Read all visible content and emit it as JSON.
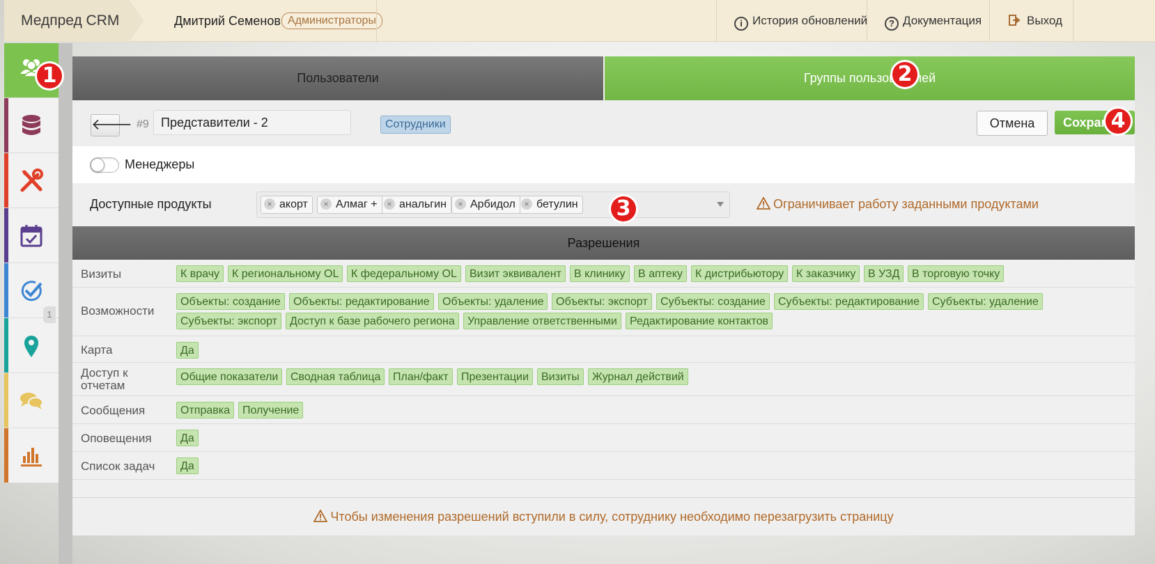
{
  "header": {
    "brand": "Медпред CRM",
    "user_name": "Дмитрий Семенов",
    "user_role": "Администраторы",
    "links": {
      "updates": "История обновлений",
      "docs": "Документация",
      "logout": "Выход"
    }
  },
  "sidebar": {
    "items": [
      {
        "name": "users",
        "icon": "users-icon",
        "color": "#7cc24e"
      },
      {
        "name": "database",
        "icon": "database-icon",
        "color": "#8e3a5a"
      },
      {
        "name": "tools",
        "icon": "tools-icon",
        "color": "#e0402a"
      },
      {
        "name": "calendar",
        "icon": "calendar-check-icon",
        "color": "#5a3f8f"
      },
      {
        "name": "tasks",
        "icon": "check-circle-icon",
        "color": "#3d86d4"
      },
      {
        "name": "map",
        "icon": "map-pin-icon",
        "color": "#1aa39b"
      },
      {
        "name": "messages",
        "icon": "chat-icon",
        "color": "#e7c45e"
      },
      {
        "name": "reports",
        "icon": "bar-chart-icon",
        "color": "#d0752a"
      }
    ],
    "tab_badge": "1"
  },
  "tabs": {
    "users": "Пользователи",
    "groups": "Группы пользователей"
  },
  "group": {
    "id": "#9",
    "name": "Представители - 2",
    "type_badge": "Сотрудники",
    "cancel": "Отмена",
    "save": "Сохранить",
    "managers_toggle": "Менеджеры",
    "managers_on": false
  },
  "products": {
    "label": "Доступные продукты",
    "selected": [
      "акорт",
      "Алмаг +",
      "анальгин",
      "Арбидол",
      "бетулин"
    ],
    "warning": "Ограничивает работу заданными продуктами"
  },
  "permissions": {
    "title": "Разрешения",
    "rows": [
      {
        "label": "Визиты",
        "tags": [
          "К врачу",
          "К региональному OL",
          "К федеральному OL",
          "Визит эквивалент",
          "В клинику",
          "В аптеку",
          "К дистрибьютору",
          "К заказчику",
          "В УЗД",
          "В торговую точку"
        ]
      },
      {
        "label": "Возможности",
        "tags": [
          "Объекты: создание",
          "Объекты: редактирование",
          "Объекты: удаление",
          "Объекты: экспорт",
          "Субъекты: создание",
          "Субъекты: редактирование",
          "Субъекты: удаление",
          "Субъекты: экспорт",
          "Доступ к базе рабочего региона",
          "Управление ответственными",
          "Редактирование контактов"
        ]
      },
      {
        "label": "Карта",
        "tags": [
          "Да"
        ]
      },
      {
        "label": "Доступ к отчетам",
        "tags": [
          "Общие показатели",
          "Сводная таблица",
          "План/факт",
          "Презентации",
          "Визиты",
          "Журнал действий"
        ]
      },
      {
        "label": "Сообщения",
        "tags": [
          "Отправка",
          "Получение"
        ]
      },
      {
        "label": "Оповещения",
        "tags": [
          "Да"
        ]
      },
      {
        "label": "Список задач",
        "tags": [
          "Да"
        ]
      }
    ],
    "footer_warning": "Чтобы изменения разрешений вступили в силу, сотруднику необходимо перезагрузить страницу"
  },
  "markers": [
    "1",
    "2",
    "3",
    "4"
  ],
  "colors": {
    "accent_green": "#7cc24e",
    "tag_bg": "#c5e4b0",
    "warning_text": "#b06a2a",
    "marker_red": "#e31c1c"
  }
}
